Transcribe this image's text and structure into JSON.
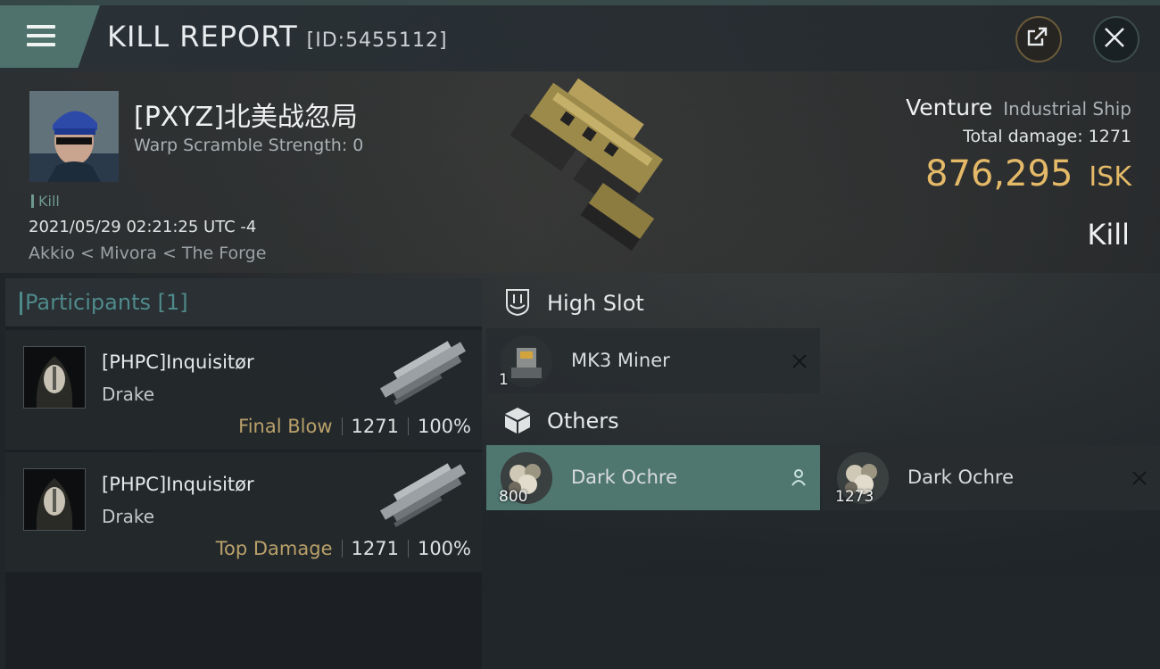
{
  "header": {
    "title": "KILL REPORT",
    "report_id": "[ID:5455112]"
  },
  "victim": {
    "name": "[PXYZ]北美战忽局",
    "warp_scramble": "Warp Scramble Strength: 0",
    "tag": "Kill",
    "timestamp": "2021/05/29 02:21:25 UTC -4",
    "location": "Akkio < Mivora < The Forge",
    "ship_name": "Venture",
    "ship_class": "Industrial Ship",
    "total_damage_label": "Total damage:",
    "total_damage": "1271",
    "isk_value": "876,295",
    "isk_unit": "ISK",
    "result": "Kill"
  },
  "participants": {
    "title": "Participants",
    "count": "[1]",
    "rows": [
      {
        "name": "[PHPC]Inquisitør",
        "ship": "Drake",
        "role": "Final Blow",
        "damage": "1271",
        "percent": "100%"
      },
      {
        "name": "[PHPC]Inquisitør",
        "ship": "Drake",
        "role": "Top Damage",
        "damage": "1271",
        "percent": "100%"
      }
    ]
  },
  "sections": {
    "high_slot": {
      "label": "High Slot",
      "items": [
        {
          "name": "MK3 Miner",
          "qty": "1",
          "status": "destroyed"
        }
      ]
    },
    "others": {
      "label": "Others",
      "items": [
        {
          "name": "Dark Ochre",
          "qty": "800",
          "status": "dropped"
        },
        {
          "name": "Dark Ochre",
          "qty": "1273",
          "status": "destroyed"
        }
      ]
    }
  },
  "icons": {
    "menu": "hamburger-icon",
    "share": "share-icon",
    "close": "close-icon",
    "high_slot": "high-slot-icon",
    "others": "cube-icon",
    "dropped": "person-icon",
    "destroyed": "x-icon"
  },
  "colors": {
    "accent": "#4f726c",
    "isk": "#e4b968",
    "role": "#b9a06a",
    "participants_title": "#4f8a8a",
    "selected_item": "#4f7770"
  }
}
